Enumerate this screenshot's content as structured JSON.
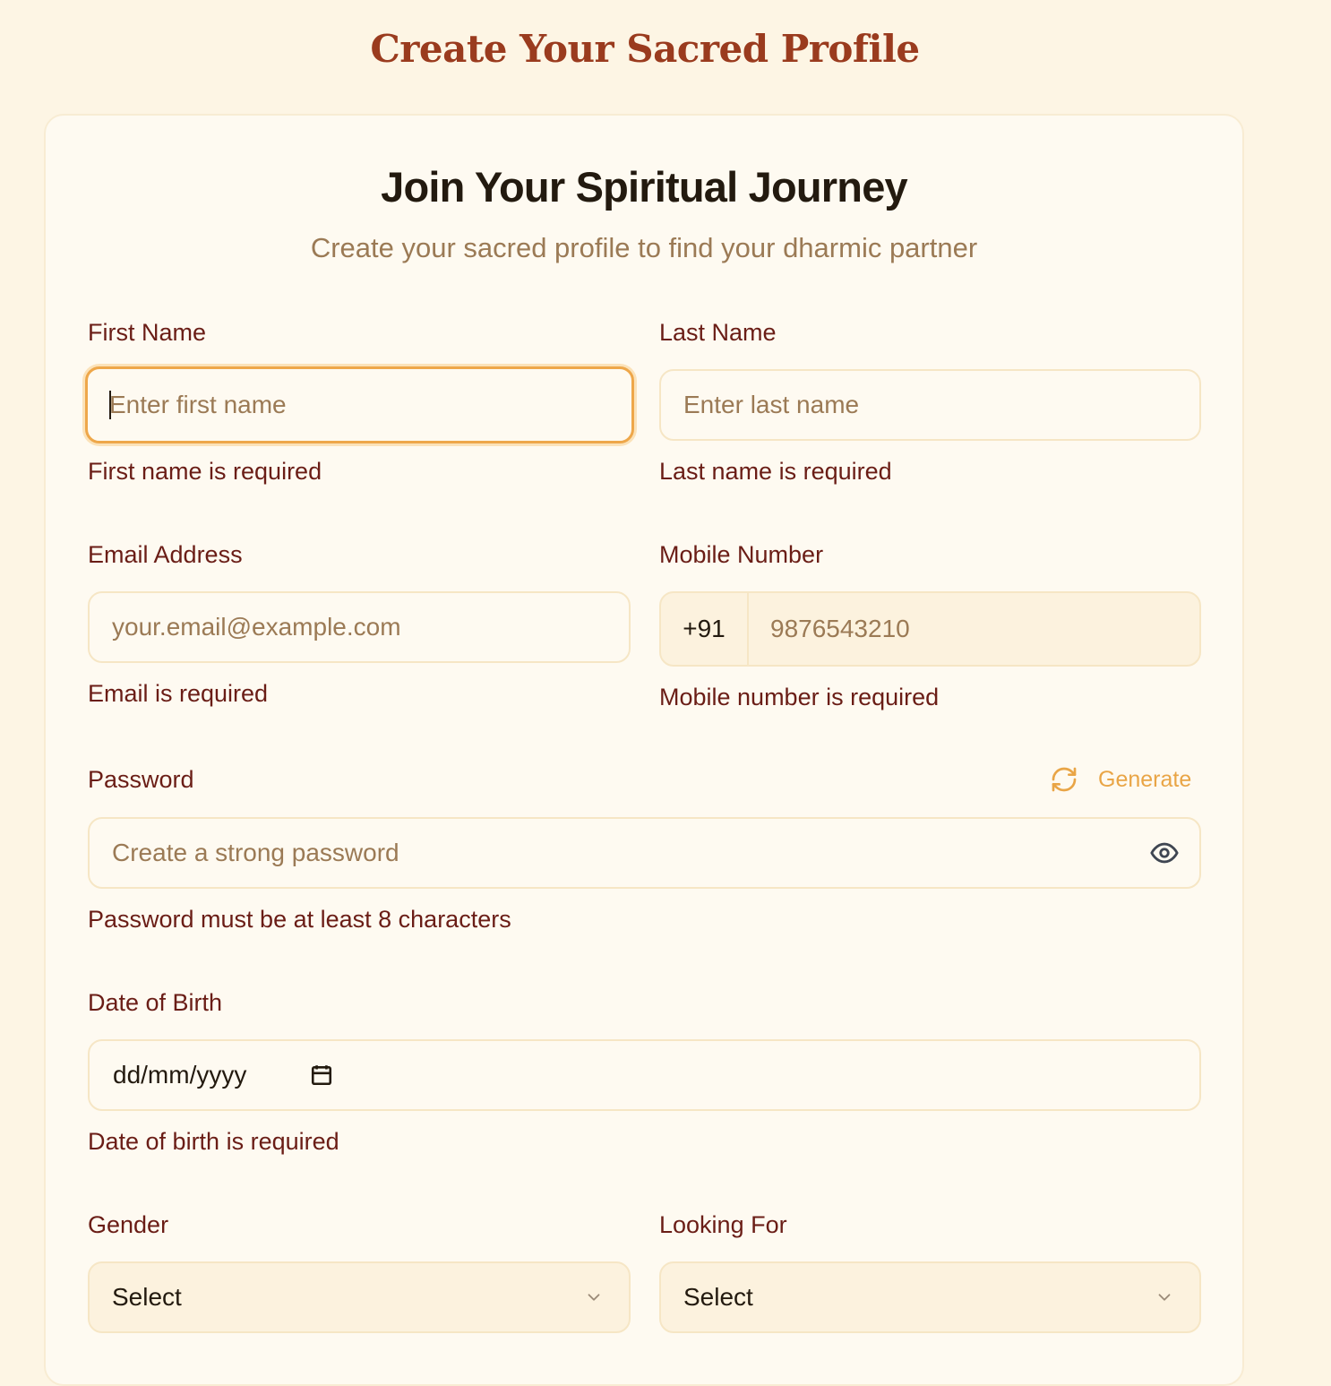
{
  "page": {
    "heading": "Create Your Sacred Profile"
  },
  "card": {
    "title": "Join Your Spiritual Journey",
    "subtitle": "Create your sacred profile to find your dharmic partner"
  },
  "form": {
    "first_name": {
      "label": "First Name",
      "placeholder": "Enter first name",
      "value": "",
      "error": "First name is required"
    },
    "last_name": {
      "label": "Last Name",
      "placeholder": "Enter last name",
      "value": "",
      "error": "Last name is required"
    },
    "email": {
      "label": "Email Address",
      "placeholder": "your.email@example.com",
      "value": "",
      "error": "Email is required"
    },
    "mobile": {
      "label": "Mobile Number",
      "country_code": "+91",
      "placeholder": "9876543210",
      "value": "",
      "error": "Mobile number is required"
    },
    "password": {
      "label": "Password",
      "placeholder": "Create a strong password",
      "value": "",
      "error": "Password must be at least 8 characters",
      "generate_label": "Generate",
      "generate_icon": "refresh-icon",
      "toggle_icon": "eye-icon"
    },
    "dob": {
      "label": "Date of Birth",
      "value": "dd/mm/yyyy",
      "icon": "calendar-icon",
      "error": "Date of birth is required"
    },
    "gender": {
      "label": "Gender",
      "selected": "Select",
      "icon": "chevron-down-icon"
    },
    "looking_for": {
      "label": "Looking For",
      "selected": "Select",
      "icon": "chevron-down-icon"
    }
  },
  "colors": {
    "page_background": "#fdf5e4",
    "card_background": "#fefaf1",
    "heading": "#9a3b1e",
    "label": "#6a1d16",
    "placeholder": "#9b7a55",
    "accent": "#e9a546",
    "focus_ring": "#eea74a"
  }
}
